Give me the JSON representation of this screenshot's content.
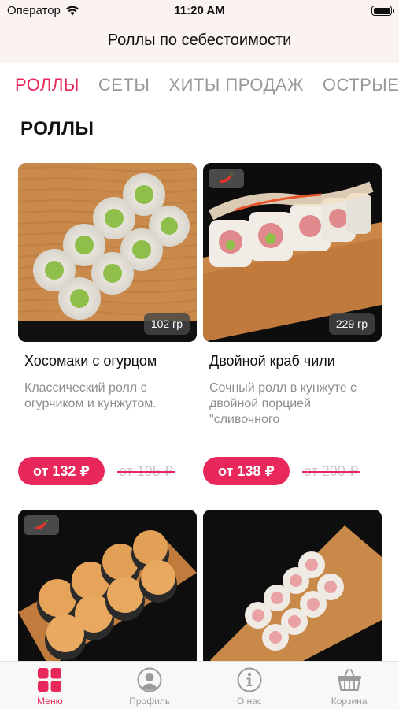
{
  "status_bar": {
    "carrier": "Оператор",
    "time": "11:20 AM"
  },
  "header": {
    "title": "Роллы по себестоимости"
  },
  "tabs": [
    {
      "label": "РОЛЛЫ",
      "active": true
    },
    {
      "label": "СЕТЫ",
      "active": false
    },
    {
      "label": "ХИТЫ ПРОДАЖ",
      "active": false
    },
    {
      "label": "ОСТРЫЕ РОЛЛЫ",
      "active": false
    }
  ],
  "section": {
    "title": "РОЛЛЫ"
  },
  "products": [
    {
      "name": "Хосомаки с огурцом",
      "description": "Классический ролл с огурчиком и кунжутом.",
      "weight": "102 гр",
      "price": "от 132 ₽",
      "old_price": "от 195 ₽",
      "spicy": false
    },
    {
      "name": "Двойной краб чили",
      "description": "Сочный ролл в кунжуте с двойной порцией \"сливочного",
      "weight": "229 гр",
      "price": "от 138 ₽",
      "old_price": "от 200 ₽",
      "spicy": true
    },
    {
      "name": "",
      "description": "",
      "weight": "",
      "price": "",
      "old_price": "",
      "spicy": true
    },
    {
      "name": "",
      "description": "",
      "weight": "",
      "price": "",
      "old_price": "",
      "spicy": false
    }
  ],
  "tabbar": [
    {
      "label": "Меню",
      "icon": "menu-grid-icon",
      "active": true
    },
    {
      "label": "Профиль",
      "icon": "profile-icon",
      "active": false
    },
    {
      "label": "О нас",
      "icon": "info-icon",
      "active": false
    },
    {
      "label": "Корзина",
      "icon": "basket-icon",
      "active": false
    }
  ],
  "colors": {
    "accent": "#e8285a",
    "header_bg": "#fbf3f2",
    "muted": "#9a9a9a"
  }
}
